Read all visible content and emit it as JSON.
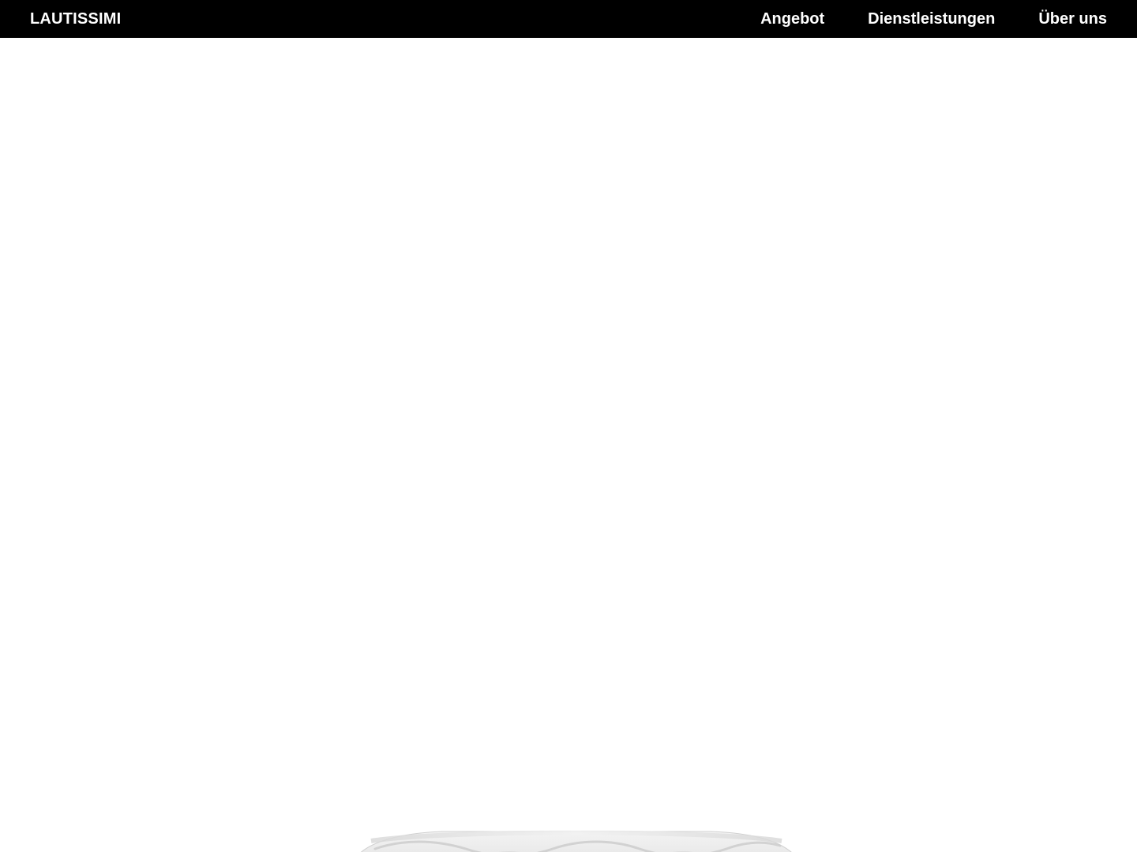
{
  "header": {
    "brand": "LAUTISSIMI",
    "nav": [
      {
        "label": "Angebot"
      },
      {
        "label": "Dienstleistungen"
      },
      {
        "label": "Über uns"
      }
    ]
  },
  "colors": {
    "header_bg": "#000000",
    "header_text": "#ffffff",
    "page_bg": "#ffffff"
  },
  "hero": {
    "image": "product-image"
  }
}
